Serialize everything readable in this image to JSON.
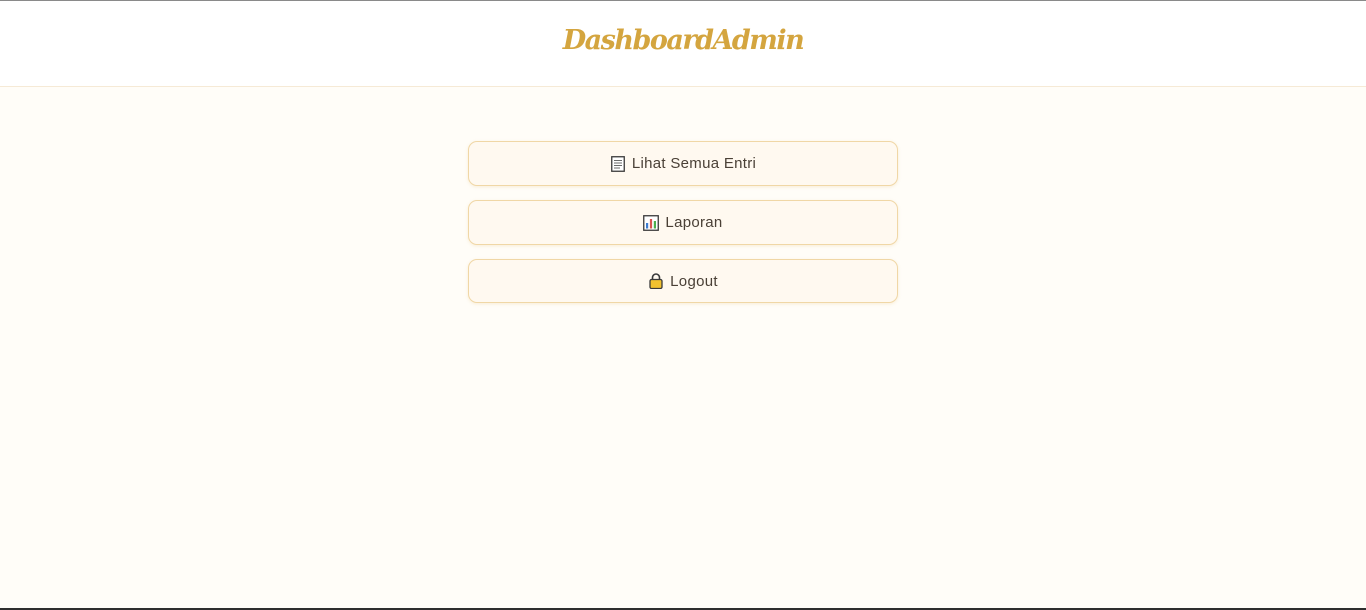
{
  "header": {
    "brand": "DashboardAdmin"
  },
  "menu": {
    "items": [
      {
        "label": "Lihat Semua Entri",
        "icon": "document-icon"
      },
      {
        "label": "Laporan",
        "icon": "bar-chart-icon"
      },
      {
        "label": "Logout",
        "icon": "lock-icon"
      }
    ]
  },
  "colors": {
    "brand": "#d4a53f",
    "page_background": "#fffdf8",
    "button_background": "#fff9f0",
    "button_border": "#f0d7a6"
  }
}
